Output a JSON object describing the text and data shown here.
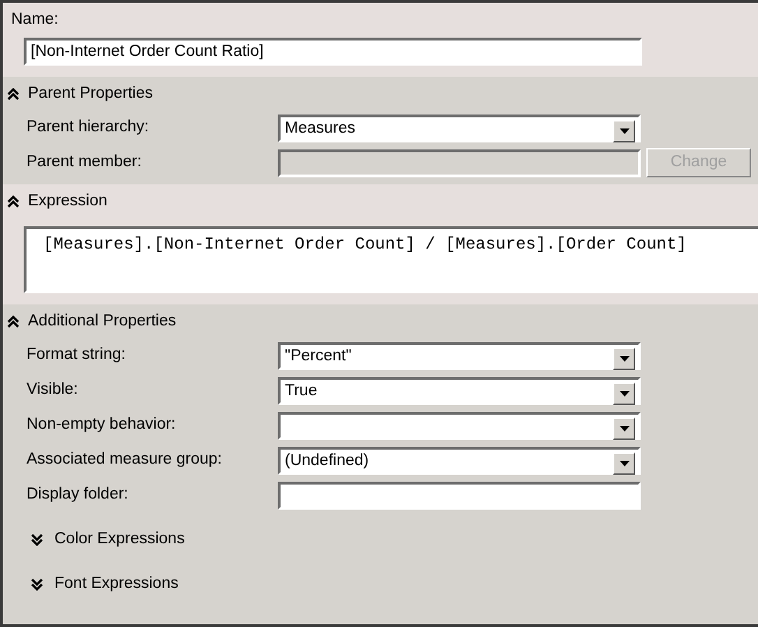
{
  "name_field": {
    "label": "Name:",
    "value": "[Non-Internet Order Count Ratio]"
  },
  "sections": [
    {
      "kind": "properties",
      "title": "Parent Properties",
      "expanded": true,
      "fields": [
        {
          "kind": "dropdown",
          "label": "Parent hierarchy:",
          "value": "Measures",
          "disabled": false
        },
        {
          "kind": "textbox",
          "label": "Parent member:",
          "disabled": true,
          "button": {
            "label": "Change",
            "disabled": true
          }
        }
      ]
    },
    {
      "kind": "expression",
      "title": "Expression",
      "expanded": true,
      "code": "[Measures].[Non-Internet Order Count] / [Measures].[Order Count]"
    },
    {
      "kind": "properties",
      "title": "Additional Properties",
      "expanded": true,
      "fields": [
        {
          "kind": "dropdown",
          "label": "Format string:",
          "value": "\"Percent\"",
          "disabled": false
        },
        {
          "kind": "dropdown",
          "label": "Visible:",
          "value": "True",
          "disabled": false
        },
        {
          "kind": "dropdown",
          "label": "Non-empty behavior:",
          "disabled": false
        },
        {
          "kind": "dropdown",
          "label": "Associated measure group:",
          "value": "(Undefined)",
          "disabled": false
        },
        {
          "kind": "textbox",
          "label": "Display folder:",
          "disabled": false
        }
      ],
      "subsections": [
        {
          "title": "Color Expressions",
          "expanded": false
        },
        {
          "title": "Font Expressions",
          "expanded": false
        }
      ]
    }
  ]
}
